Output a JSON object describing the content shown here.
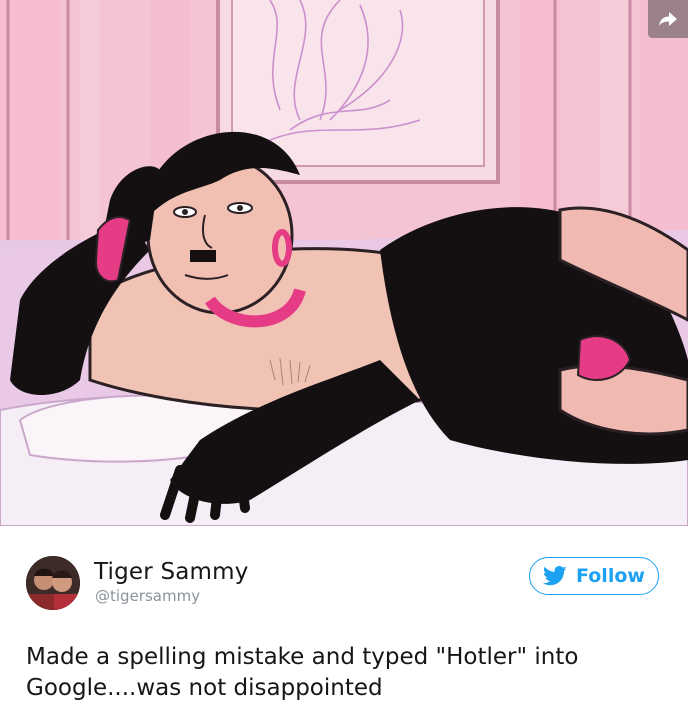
{
  "tweet": {
    "author_name": "Tiger Sammy",
    "author_handle": "@tigersammy",
    "follow_label": "Follow",
    "text": "Made a spelling mistake and typed \"Hotler\" into Google....was not disappointed"
  },
  "media": {
    "share_icon": "share-arrow-icon",
    "image_description_icon": "illustration"
  },
  "colors": {
    "accent": "#1da1f2",
    "text_primary": "#14171a",
    "text_secondary": "#8a939c"
  }
}
